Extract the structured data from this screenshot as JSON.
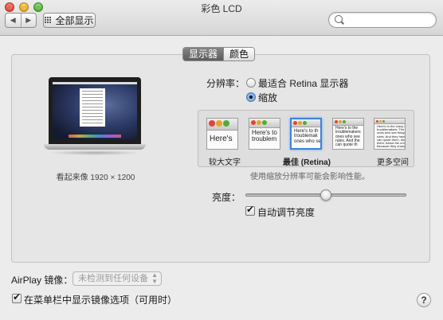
{
  "window": {
    "title": "彩色 LCD"
  },
  "toolbar": {
    "back_glyph": "◀",
    "forward_glyph": "▶",
    "show_all_label": "全部显示",
    "search_placeholder": ""
  },
  "tabs": [
    {
      "label": "显示器",
      "active": true
    },
    {
      "label": "颜色",
      "active": false
    }
  ],
  "display": {
    "looks_like": "看起来像 1920 × 1200",
    "resolution_label": "分辨率：",
    "resolution_options": [
      {
        "label": "最适合 Retina 显示器",
        "selected": false
      },
      {
        "label": "缩放",
        "selected": true
      }
    ],
    "scaled_options": [
      {
        "preview_text": "Here's",
        "caption": "较大文字",
        "selected": false
      },
      {
        "preview_text": "Here's to\ntroublem",
        "caption": "",
        "selected": false
      },
      {
        "preview_text": "Here's to th\ntroublemak\nones who se",
        "caption": "最佳 (Retina)",
        "selected": true
      },
      {
        "preview_text": "Here's to the\ntroublemakers\nones who see\nrules. And the\ncan quote th",
        "caption": "",
        "selected": false
      },
      {
        "preview_text": "Here's to the crazy on\ntroublemakers. The ro\nones who see things d\nrules. And they have n\ncan quote them, disag\nthem. About the only t\nBecause they change t",
        "caption": "更多空间",
        "selected": false
      }
    ],
    "scaling_note": "使用缩放分辨率可能会影响性能。",
    "brightness_label": "亮度：",
    "brightness_level": 0.5,
    "auto_brightness": {
      "label": "自动调节亮度",
      "checked": true
    }
  },
  "airplay": {
    "label": "AirPlay 镜像：",
    "selected": "未检测到任何设备",
    "enabled": false
  },
  "menu_bar_option": {
    "label": "在菜单栏中显示镜像选项（可用时）",
    "checked": true
  },
  "help_label": "?",
  "colors": {
    "accent": "#3d83d8",
    "selected_tab": "#6e6e6e"
  }
}
